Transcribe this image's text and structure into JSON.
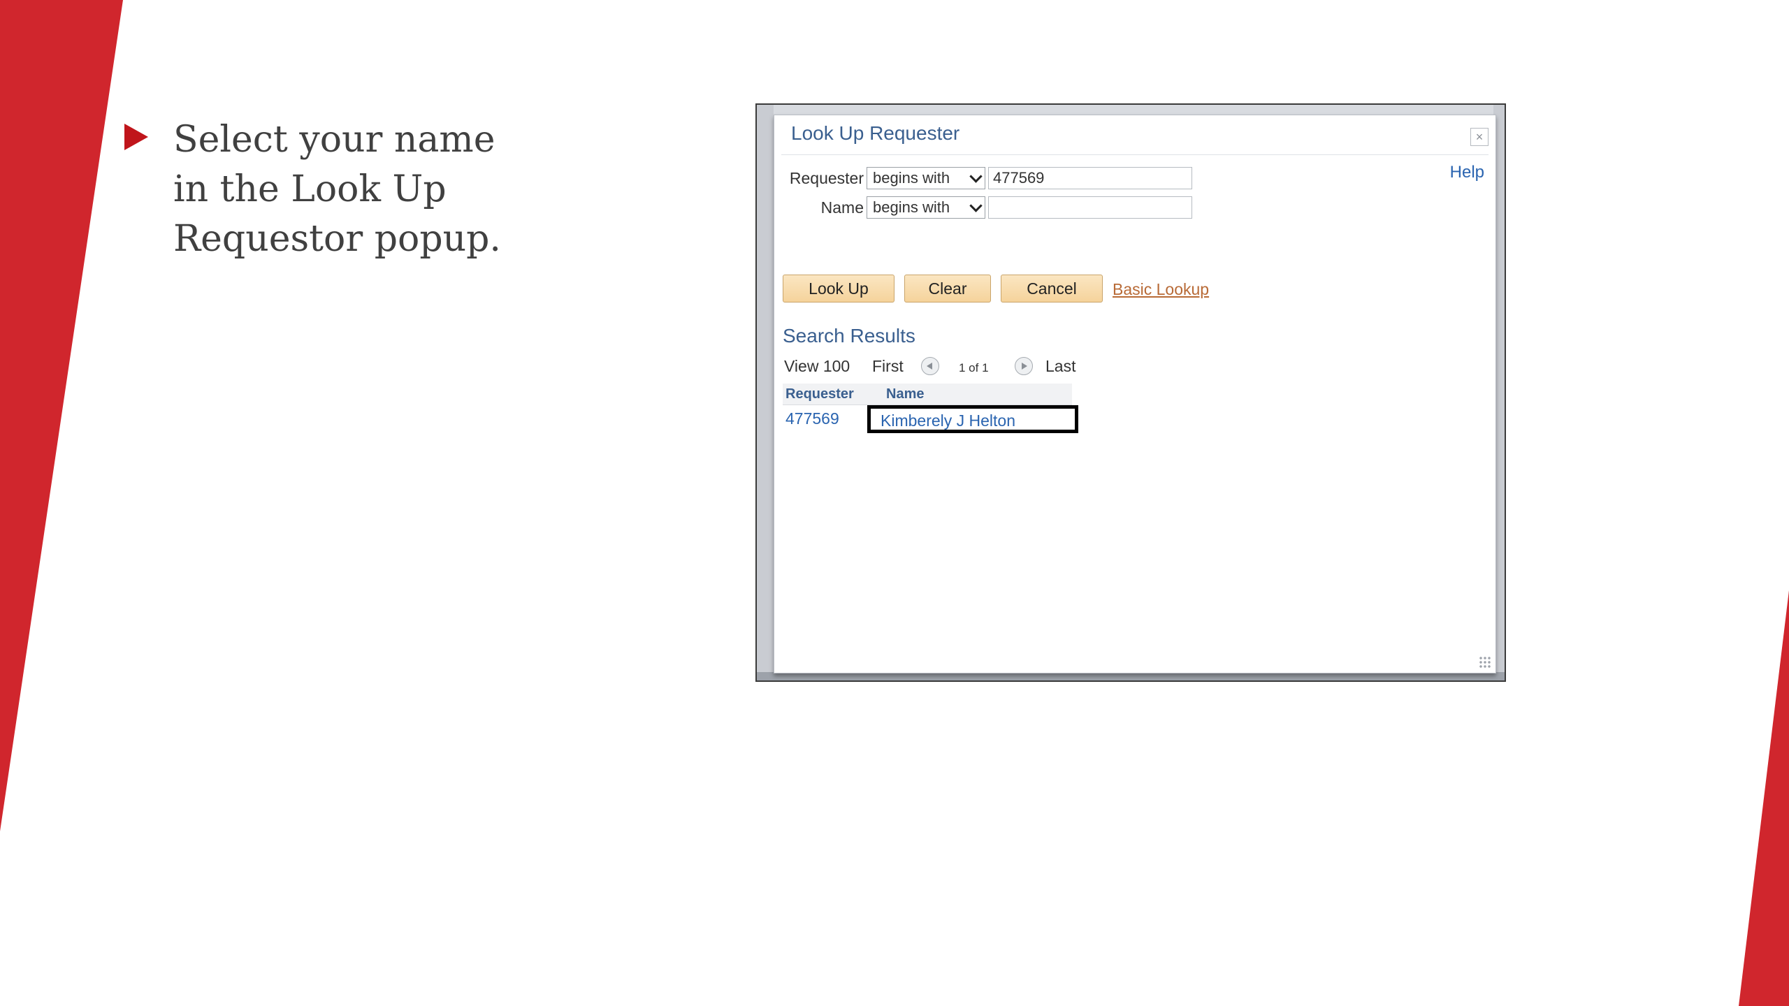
{
  "slide": {
    "bullet_text": "Select your name in the Look Up Requestor popup.",
    "accent_color": "#d0262d"
  },
  "dialog": {
    "title": "Look Up Requester",
    "close_symbol": "×",
    "help_label": "Help",
    "criteria": [
      {
        "label": "Requester",
        "operator": "begins with",
        "value": "477569"
      },
      {
        "label": "Name",
        "operator": "begins with",
        "value": ""
      }
    ],
    "buttons": {
      "lookup": "Look Up",
      "clear": "Clear",
      "cancel": "Cancel",
      "basic_lookup": "Basic Lookup"
    },
    "results": {
      "heading": "Search Results",
      "view": "View 100",
      "first": "First",
      "page_count": "1 of 1",
      "last": "Last",
      "columns": [
        "Requester",
        "Name"
      ],
      "rows": [
        {
          "requester": "477569",
          "name": "Kimberely J Helton"
        }
      ]
    }
  }
}
